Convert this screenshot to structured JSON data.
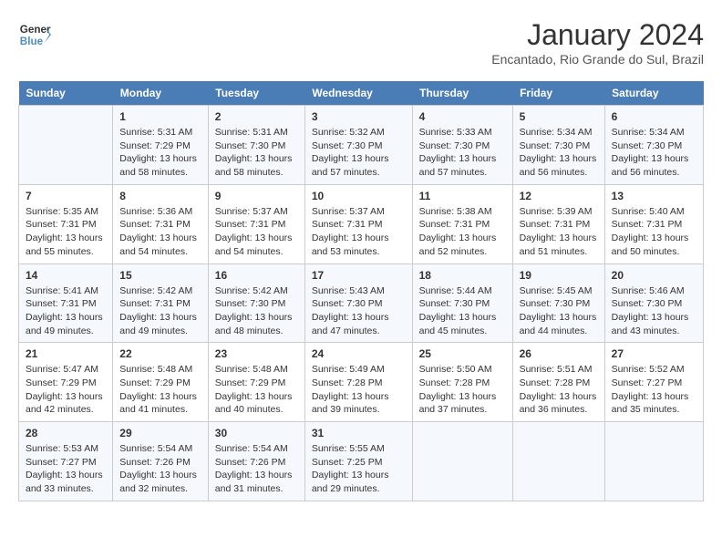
{
  "logo": {
    "line1": "General",
    "line2": "Blue"
  },
  "title": "January 2024",
  "subtitle": "Encantado, Rio Grande do Sul, Brazil",
  "days_header": [
    "Sunday",
    "Monday",
    "Tuesday",
    "Wednesday",
    "Thursday",
    "Friday",
    "Saturday"
  ],
  "weeks": [
    [
      {
        "day": "",
        "sunrise": "",
        "sunset": "",
        "daylight": ""
      },
      {
        "day": "1",
        "sunrise": "Sunrise: 5:31 AM",
        "sunset": "Sunset: 7:29 PM",
        "daylight": "Daylight: 13 hours and 58 minutes."
      },
      {
        "day": "2",
        "sunrise": "Sunrise: 5:31 AM",
        "sunset": "Sunset: 7:30 PM",
        "daylight": "Daylight: 13 hours and 58 minutes."
      },
      {
        "day": "3",
        "sunrise": "Sunrise: 5:32 AM",
        "sunset": "Sunset: 7:30 PM",
        "daylight": "Daylight: 13 hours and 57 minutes."
      },
      {
        "day": "4",
        "sunrise": "Sunrise: 5:33 AM",
        "sunset": "Sunset: 7:30 PM",
        "daylight": "Daylight: 13 hours and 57 minutes."
      },
      {
        "day": "5",
        "sunrise": "Sunrise: 5:34 AM",
        "sunset": "Sunset: 7:30 PM",
        "daylight": "Daylight: 13 hours and 56 minutes."
      },
      {
        "day": "6",
        "sunrise": "Sunrise: 5:34 AM",
        "sunset": "Sunset: 7:30 PM",
        "daylight": "Daylight: 13 hours and 56 minutes."
      }
    ],
    [
      {
        "day": "7",
        "sunrise": "Sunrise: 5:35 AM",
        "sunset": "Sunset: 7:31 PM",
        "daylight": "Daylight: 13 hours and 55 minutes."
      },
      {
        "day": "8",
        "sunrise": "Sunrise: 5:36 AM",
        "sunset": "Sunset: 7:31 PM",
        "daylight": "Daylight: 13 hours and 54 minutes."
      },
      {
        "day": "9",
        "sunrise": "Sunrise: 5:37 AM",
        "sunset": "Sunset: 7:31 PM",
        "daylight": "Daylight: 13 hours and 54 minutes."
      },
      {
        "day": "10",
        "sunrise": "Sunrise: 5:37 AM",
        "sunset": "Sunset: 7:31 PM",
        "daylight": "Daylight: 13 hours and 53 minutes."
      },
      {
        "day": "11",
        "sunrise": "Sunrise: 5:38 AM",
        "sunset": "Sunset: 7:31 PM",
        "daylight": "Daylight: 13 hours and 52 minutes."
      },
      {
        "day": "12",
        "sunrise": "Sunrise: 5:39 AM",
        "sunset": "Sunset: 7:31 PM",
        "daylight": "Daylight: 13 hours and 51 minutes."
      },
      {
        "day": "13",
        "sunrise": "Sunrise: 5:40 AM",
        "sunset": "Sunset: 7:31 PM",
        "daylight": "Daylight: 13 hours and 50 minutes."
      }
    ],
    [
      {
        "day": "14",
        "sunrise": "Sunrise: 5:41 AM",
        "sunset": "Sunset: 7:31 PM",
        "daylight": "Daylight: 13 hours and 49 minutes."
      },
      {
        "day": "15",
        "sunrise": "Sunrise: 5:42 AM",
        "sunset": "Sunset: 7:31 PM",
        "daylight": "Daylight: 13 hours and 49 minutes."
      },
      {
        "day": "16",
        "sunrise": "Sunrise: 5:42 AM",
        "sunset": "Sunset: 7:30 PM",
        "daylight": "Daylight: 13 hours and 48 minutes."
      },
      {
        "day": "17",
        "sunrise": "Sunrise: 5:43 AM",
        "sunset": "Sunset: 7:30 PM",
        "daylight": "Daylight: 13 hours and 47 minutes."
      },
      {
        "day": "18",
        "sunrise": "Sunrise: 5:44 AM",
        "sunset": "Sunset: 7:30 PM",
        "daylight": "Daylight: 13 hours and 45 minutes."
      },
      {
        "day": "19",
        "sunrise": "Sunrise: 5:45 AM",
        "sunset": "Sunset: 7:30 PM",
        "daylight": "Daylight: 13 hours and 44 minutes."
      },
      {
        "day": "20",
        "sunrise": "Sunrise: 5:46 AM",
        "sunset": "Sunset: 7:30 PM",
        "daylight": "Daylight: 13 hours and 43 minutes."
      }
    ],
    [
      {
        "day": "21",
        "sunrise": "Sunrise: 5:47 AM",
        "sunset": "Sunset: 7:29 PM",
        "daylight": "Daylight: 13 hours and 42 minutes."
      },
      {
        "day": "22",
        "sunrise": "Sunrise: 5:48 AM",
        "sunset": "Sunset: 7:29 PM",
        "daylight": "Daylight: 13 hours and 41 minutes."
      },
      {
        "day": "23",
        "sunrise": "Sunrise: 5:48 AM",
        "sunset": "Sunset: 7:29 PM",
        "daylight": "Daylight: 13 hours and 40 minutes."
      },
      {
        "day": "24",
        "sunrise": "Sunrise: 5:49 AM",
        "sunset": "Sunset: 7:28 PM",
        "daylight": "Daylight: 13 hours and 39 minutes."
      },
      {
        "day": "25",
        "sunrise": "Sunrise: 5:50 AM",
        "sunset": "Sunset: 7:28 PM",
        "daylight": "Daylight: 13 hours and 37 minutes."
      },
      {
        "day": "26",
        "sunrise": "Sunrise: 5:51 AM",
        "sunset": "Sunset: 7:28 PM",
        "daylight": "Daylight: 13 hours and 36 minutes."
      },
      {
        "day": "27",
        "sunrise": "Sunrise: 5:52 AM",
        "sunset": "Sunset: 7:27 PM",
        "daylight": "Daylight: 13 hours and 35 minutes."
      }
    ],
    [
      {
        "day": "28",
        "sunrise": "Sunrise: 5:53 AM",
        "sunset": "Sunset: 7:27 PM",
        "daylight": "Daylight: 13 hours and 33 minutes."
      },
      {
        "day": "29",
        "sunrise": "Sunrise: 5:54 AM",
        "sunset": "Sunset: 7:26 PM",
        "daylight": "Daylight: 13 hours and 32 minutes."
      },
      {
        "day": "30",
        "sunrise": "Sunrise: 5:54 AM",
        "sunset": "Sunset: 7:26 PM",
        "daylight": "Daylight: 13 hours and 31 minutes."
      },
      {
        "day": "31",
        "sunrise": "Sunrise: 5:55 AM",
        "sunset": "Sunset: 7:25 PM",
        "daylight": "Daylight: 13 hours and 29 minutes."
      },
      {
        "day": "",
        "sunrise": "",
        "sunset": "",
        "daylight": ""
      },
      {
        "day": "",
        "sunrise": "",
        "sunset": "",
        "daylight": ""
      },
      {
        "day": "",
        "sunrise": "",
        "sunset": "",
        "daylight": ""
      }
    ]
  ]
}
